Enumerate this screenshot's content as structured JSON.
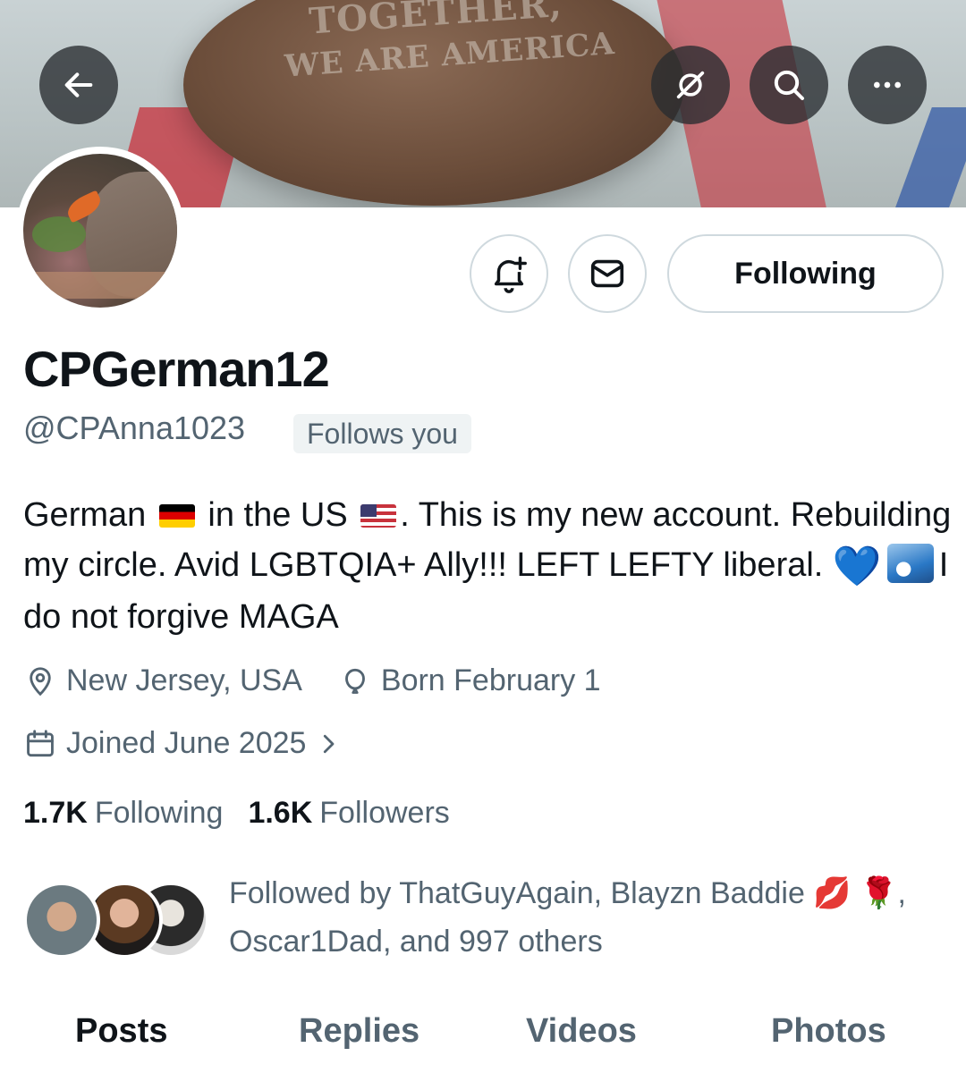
{
  "header": {
    "banner_text_top": "TOGETHER,",
    "banner_text": "WE ARE AMERICA"
  },
  "profile": {
    "display_name": "CPGerman12",
    "handle": "@CPAnna1023",
    "follows_you": "Follows you",
    "bio": {
      "part1": "German",
      "part2": "in the US",
      "part3": ". This is my new account. Rebuilding my circle. Avid LGBTQIA+ Ally!!! LEFT LEFTY liberal.",
      "heart": "💙",
      "part4": "I do not forgive MAGA"
    },
    "location": "New Jersey, USA",
    "birthday": "Born February 1",
    "joined": "Joined June 2025"
  },
  "actions": {
    "following_label": "Following"
  },
  "stats": {
    "following_count": "1.7K",
    "following_label": "Following",
    "followers_count": "1.6K",
    "followers_label": "Followers"
  },
  "followed_by": {
    "line1": "Followed by ThatGuyAgain, Blayzn Baddie",
    "lips": "💋",
    "rose": "🌹",
    "line2": ", Oscar1Dad, and 997 others"
  },
  "tabs": [
    {
      "label": "Posts",
      "active": true
    },
    {
      "label": "Replies",
      "active": false
    },
    {
      "label": "Videos",
      "active": false
    },
    {
      "label": "Photos",
      "active": false
    }
  ],
  "icons": {
    "back": "arrow-left-icon",
    "grok": "grok-icon",
    "search": "search-icon",
    "more": "more-icon",
    "notify": "bell-plus-icon",
    "message": "envelope-icon",
    "location": "location-pin-icon",
    "birthday": "balloon-icon",
    "joined": "calendar-icon",
    "chevron": "chevron-right-icon"
  },
  "colors": {
    "text_primary": "#0f1419",
    "text_secondary": "#536471",
    "border": "#cfd9de",
    "badge_bg": "#eff3f4"
  }
}
